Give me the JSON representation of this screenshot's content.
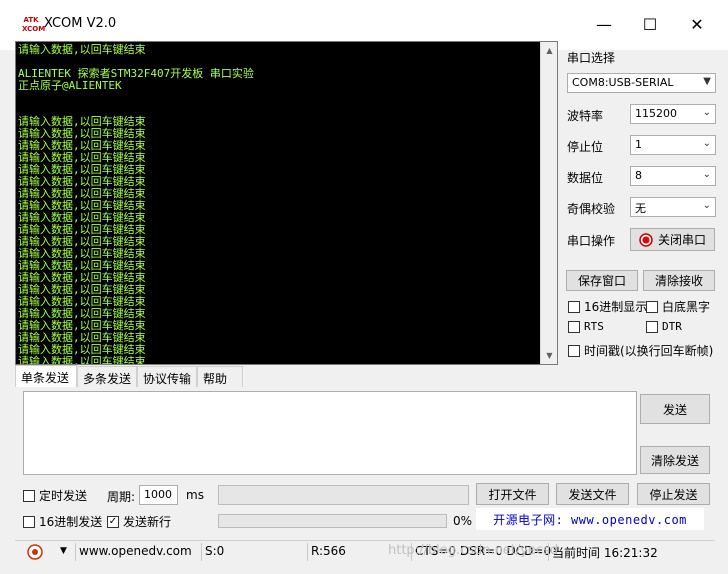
{
  "window": {
    "logo_text": "ATK XCOM",
    "title": "XCOM V2.0",
    "minimize_label": "—",
    "maximize_label": "☐",
    "close_label": "✕"
  },
  "console": {
    "lines": "请输入数据,以回车键结束\n\nALIENTEK 探索者STM32F407开发板 串口实验\n正点原子@ALIENTEK\n\n\n请输入数据,以回车键结束\n请输入数据,以回车键结束\n请输入数据,以回车键结束\n请输入数据,以回车键结束\n请输入数据,以回车键结束\n请输入数据,以回车键结束\n请输入数据,以回车键结束\n请输入数据,以回车键结束\n请输入数据,以回车键结束\n请输入数据,以回车键结束\n请输入数据,以回车键结束\n请输入数据,以回车键结束\n请输入数据,以回车键结束\n请输入数据,以回车键结束\n请输入数据,以回车键结束\n请输入数据,以回车键结束\n请输入数据,以回车键结束\n请输入数据,以回车键结束\n请输入数据,以回车键结束\n请输入数据,以回车键结束\n请输入数据,以回车键结束\n请输入数据,以回车键结束\n请输入数据,以回车键结束\n请输入数据,以回车键结束\n请输入数据,以回车键结束",
    "text_color": "#a6ff4d",
    "background": "#000000"
  },
  "serial": {
    "port_label": "串口选择",
    "port_value": "COM8:USB-SERIAL",
    "baud_label": "波特率",
    "baud_value": "115200",
    "stop_label": "停止位",
    "stop_value": "1",
    "data_label": "数据位",
    "data_value": "8",
    "parity_label": "奇偶校验",
    "parity_value": "无",
    "op_label": "串口操作",
    "op_button": "关闭串口"
  },
  "receive": {
    "save_button": "保存窗口",
    "clear_button": "清除接收",
    "hex_display": "16进制显示",
    "white_black": "白底黑字",
    "rts": "RTS",
    "dtr": "DTR",
    "timestamp": "时间戳(以换行回车断帧)"
  },
  "tabs": [
    "单条发送",
    "多条发送",
    "协议传输",
    "帮助"
  ],
  "send": {
    "send_button": "发送",
    "clear_send_button": "清除发送",
    "timed_send": "定时发送",
    "period_label": "周期:",
    "period_value": "1000",
    "period_unit": "ms",
    "open_file": "打开文件",
    "send_file": "发送文件",
    "stop_send": "停止发送",
    "hex_send": "16进制发送",
    "send_newline": "发送新行",
    "progress_percent": "0%",
    "progress": 0,
    "promo": "开源电子网: www.openedv.com"
  },
  "status": {
    "url": "www.openedv.com",
    "sent": "S:0",
    "received": "R:566",
    "lines": "CTS=0 DSR=0 DCD=0",
    "time": "当前时间 16:21:32",
    "watermark": "http://blog.csdn.net/yecsd"
  }
}
